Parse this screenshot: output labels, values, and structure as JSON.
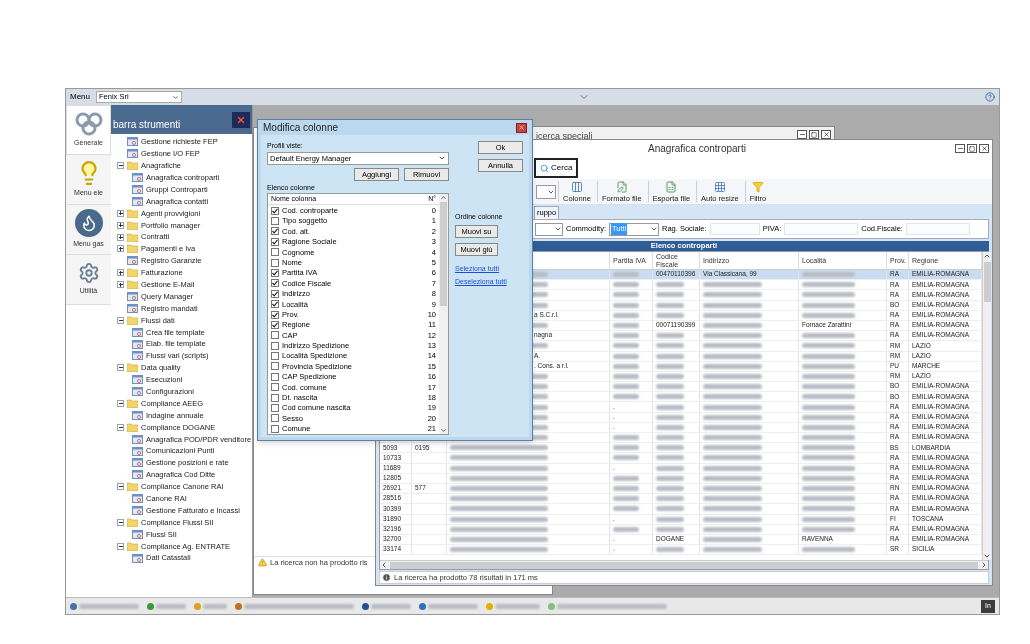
{
  "menu_bar": {
    "label": "Menu",
    "company": "Fenix Srl"
  },
  "nav": [
    {
      "label": "Generale",
      "kind": "knot",
      "selected": true
    },
    {
      "label": "Menu ele",
      "kind": "bulb",
      "selected": false
    },
    {
      "label": "Menu gas",
      "kind": "flame",
      "selected": false
    },
    {
      "label": "Utilità",
      "kind": "gear",
      "selected": false
    }
  ],
  "tool_panel": {
    "title": "barra strumenti"
  },
  "tree": [
    {
      "label": "Gestione richieste FEP",
      "kind": "item"
    },
    {
      "label": "Gestione I/O FEP",
      "kind": "item"
    },
    {
      "label": "Anagrafiche",
      "kind": "folder",
      "expanded": true,
      "children": [
        {
          "label": "Anagrafica controparti",
          "kind": "item"
        },
        {
          "label": "Gruppi Controparti",
          "kind": "item"
        },
        {
          "label": "Anagrafica contatti",
          "kind": "item"
        }
      ]
    },
    {
      "label": "Agenti provvigioni",
      "kind": "folder",
      "expanded": false
    },
    {
      "label": "Portfolio manager",
      "kind": "folder",
      "expanded": false
    },
    {
      "label": "Contratti",
      "kind": "folder",
      "expanded": false
    },
    {
      "label": "Pagamenti e Iva",
      "kind": "folder",
      "expanded": false
    },
    {
      "label": "Registro Garanzie",
      "kind": "item"
    },
    {
      "label": "Fatturazione",
      "kind": "folder",
      "expanded": false
    },
    {
      "label": "Gestione E-Mail",
      "kind": "folder",
      "expanded": false
    },
    {
      "label": "Query Manager",
      "kind": "item"
    },
    {
      "label": "Registro mandati",
      "kind": "item"
    },
    {
      "label": "Flussi dati",
      "kind": "folder",
      "expanded": true,
      "children": [
        {
          "label": "Crea file template",
          "kind": "item"
        },
        {
          "label": "Elab. file template",
          "kind": "item"
        },
        {
          "label": "Flussi vari (scripts)",
          "kind": "item"
        }
      ]
    },
    {
      "label": "Data quality",
      "kind": "folder",
      "expanded": true,
      "children": [
        {
          "label": "Esecuzioni",
          "kind": "item"
        },
        {
          "label": "Configurazioni",
          "kind": "item"
        }
      ]
    },
    {
      "label": "Compliance AEEG",
      "kind": "folder",
      "expanded": true,
      "children": [
        {
          "label": "Indagine annuale",
          "kind": "item"
        }
      ]
    },
    {
      "label": "Compliance DOGANE",
      "kind": "folder",
      "expanded": true,
      "children": [
        {
          "label": "Anagrafica POD/PDR venditore",
          "kind": "item"
        },
        {
          "label": "Comunicazioni Punti",
          "kind": "item"
        },
        {
          "label": "Gestione posizioni e rate",
          "kind": "item"
        },
        {
          "label": "Anagrafica Cod Ditte",
          "kind": "item"
        }
      ]
    },
    {
      "label": "Compliance Canone RAI",
      "kind": "folder",
      "expanded": true,
      "children": [
        {
          "label": "Canone RAI",
          "kind": "item"
        },
        {
          "label": "Gestione Fatturato e Incassi",
          "kind": "item"
        }
      ]
    },
    {
      "label": "Compliance Flussi SII",
      "kind": "folder",
      "expanded": true,
      "children": [
        {
          "label": "Flussi SII",
          "kind": "item"
        }
      ]
    },
    {
      "label": "Compliance Ag. ENTRATE",
      "kind": "folder",
      "expanded": true,
      "children": [
        {
          "label": "Dati Catastali",
          "kind": "item"
        }
      ]
    }
  ],
  "back_window": {
    "title": "icerca speciali"
  },
  "left_window": {
    "message": "La ricerca non ha prodotto ris"
  },
  "main_window": {
    "title": "Anagrafica controparti",
    "search_button": "Cerca",
    "toolbar": [
      {
        "label": "Colonne",
        "kind": "columns"
      },
      {
        "label": "Formato file",
        "kind": "format"
      },
      {
        "label": "Esporta file",
        "kind": "export"
      },
      {
        "label": "Auto resize",
        "kind": "resize"
      },
      {
        "label": "Filtro",
        "kind": "filter"
      }
    ],
    "tabs": [
      {
        "label": "ruppo",
        "selected": true
      }
    ],
    "filters": {
      "commodity_label": "Commodity:",
      "commodity_value": "Tutti",
      "rag_label": "Rag. Sociale:",
      "piva_label": "PIVA:",
      "cf_label": "Cod.Fiscale:"
    },
    "list_title": "Elenco controparti",
    "columns": [
      "Partita IVA",
      "Codice Fiscale",
      "Indirizzo",
      "Località",
      "Prov.",
      "Regione"
    ],
    "rows": [
      {
        "selected": true,
        "codice": "00470110396",
        "indirizzo": "Via Classicana, 99",
        "prov": "RA",
        "regione": "EMILIA-ROMAGNA"
      },
      {
        "selected": false,
        "prov": "RA",
        "regione": "EMILIA-ROMAGNA"
      },
      {
        "selected": false,
        "prov": "RA",
        "regione": "EMILIA-ROMAGNA"
      },
      {
        "selected": false,
        "prov": "BO",
        "regione": "EMILIA-ROMAGNA"
      },
      {
        "selected": false,
        "name": "a S.C.r.l.",
        "prov": "RA",
        "regione": "EMILIA-ROMAGNA"
      },
      {
        "selected": false,
        "codice": "00071190399",
        "localita": "Fornace Zarattini",
        "prov": "RA",
        "regione": "EMILIA-ROMAGNA"
      },
      {
        "selected": false,
        "name": "nagna",
        "prov": "RA",
        "regione": "EMILIA-ROMAGNA"
      },
      {
        "selected": false,
        "prov": "RM",
        "regione": "LAZIO"
      },
      {
        "selected": false,
        "name": "A.",
        "prov": "RM",
        "regione": "LAZIO"
      },
      {
        "selected": false,
        "name": ". Cons. a r.l.",
        "prov": "PU",
        "regione": "MARCHE"
      },
      {
        "selected": false,
        "prov": "RM",
        "regione": "LAZIO"
      },
      {
        "selected": false,
        "prov": "BO",
        "regione": "EMILIA-ROMAGNA"
      },
      {
        "selected": false,
        "prov": "BO",
        "regione": "EMILIA-ROMAGNA"
      },
      {
        "selected": false,
        "partita": ".",
        "prov": "RA",
        "regione": "EMILIA-ROMAGNA"
      },
      {
        "selected": false,
        "partita": ".",
        "prov": "RA",
        "regione": "EMILIA-ROMAGNA"
      },
      {
        "selected": false,
        "partita": ".",
        "prov": "RA",
        "regione": "EMILIA-ROMAGNA"
      },
      {
        "selected": false,
        "prov": "RA",
        "regione": "EMILIA-ROMAGNA"
      },
      {
        "selected": false,
        "id": "5093",
        "code": "0195",
        "prov": "BS",
        "regione": "LOMBARDIA"
      },
      {
        "selected": false,
        "id": "10733",
        "prov": "RA",
        "regione": "EMILIA-ROMAGNA"
      },
      {
        "selected": false,
        "id": "11689",
        "partita": ".",
        "prov": "RA",
        "regione": "EMILIA-ROMAGNA"
      },
      {
        "selected": false,
        "id": "12805",
        "prov": "RA",
        "regione": "EMILIA-ROMAGNA"
      },
      {
        "selected": false,
        "id": "26921",
        "code": "577",
        "prov": "RN",
        "regione": "EMILIA-ROMAGNA"
      },
      {
        "selected": false,
        "id": "28516",
        "prov": "RA",
        "regione": "EMILIA-ROMAGNA"
      },
      {
        "selected": false,
        "id": "30399",
        "prov": "RA",
        "regione": "EMILIA-ROMAGNA"
      },
      {
        "selected": false,
        "id": "31890",
        "partita": ".",
        "prov": "FI",
        "regione": "TOSCANA"
      },
      {
        "selected": false,
        "id": "32196",
        "prov": "RA",
        "regione": "EMILIA-ROMAGNA"
      },
      {
        "selected": false,
        "id": "32700",
        "partita": ".",
        "codice": "DOGANE",
        "localita": "RAVENNA",
        "prov": "RA",
        "regione": "EMILIA-ROMAGNA"
      },
      {
        "selected": false,
        "id": "33174",
        "partita": ".",
        "prov": "SR",
        "regione": "SICILIA"
      }
    ],
    "status": "La ricerca ha prodotto 78 risultati in 171 ms"
  },
  "dialog": {
    "title": "Modifica colonne",
    "profile_label": "Profili viste:",
    "profile_value": "Default Energy Manager",
    "add": "Aggiungi",
    "remove": "Rimuovi",
    "list_label": "Elenco colonne",
    "name_header": "Nome colonna",
    "number_header": "N°",
    "columns": [
      {
        "name": "Cod. controparte",
        "number": "0",
        "checked": true
      },
      {
        "name": "Tipo soggetto",
        "number": "1",
        "checked": false
      },
      {
        "name": "Cod. alt.",
        "number": "2",
        "checked": true
      },
      {
        "name": "Ragione Sociale",
        "number": "3",
        "checked": true
      },
      {
        "name": "Cognome",
        "number": "4",
        "checked": false
      },
      {
        "name": "Nome",
        "number": "5",
        "checked": false
      },
      {
        "name": "Partita IVA",
        "number": "6",
        "checked": true
      },
      {
        "name": "Codice Fiscale",
        "number": "7",
        "checked": true
      },
      {
        "name": "Indirizzo",
        "number": "8",
        "checked": true
      },
      {
        "name": "Località",
        "number": "9",
        "checked": true
      },
      {
        "name": "Prov.",
        "number": "10",
        "checked": true
      },
      {
        "name": "Regione",
        "number": "11",
        "checked": true
      },
      {
        "name": "CAP",
        "number": "12",
        "checked": false
      },
      {
        "name": "Indirizzo Spedizione",
        "number": "13",
        "checked": false
      },
      {
        "name": "Località Spedizione",
        "number": "14",
        "checked": false
      },
      {
        "name": "Provincia Spedizione",
        "number": "15",
        "checked": false
      },
      {
        "name": "CAP Spedizione",
        "number": "16",
        "checked": false
      },
      {
        "name": "Cod. comune",
        "number": "17",
        "checked": false
      },
      {
        "name": "Dt. nascita",
        "number": "18",
        "checked": false
      },
      {
        "name": "Cod comune nascita",
        "number": "19",
        "checked": false
      },
      {
        "name": "Sesso",
        "number": "20",
        "checked": false
      },
      {
        "name": "Comune",
        "number": "21",
        "checked": false
      }
    ],
    "ok": "Ok",
    "cancel": "Annulla",
    "order_label": "Ordine colonne",
    "move_up": "Muovi su",
    "move_down": "Muovi giù",
    "select_all": "Seleziona tutti",
    "deselect_all": "Deseleziona tutti"
  },
  "status_bar": {
    "badge": "In"
  }
}
